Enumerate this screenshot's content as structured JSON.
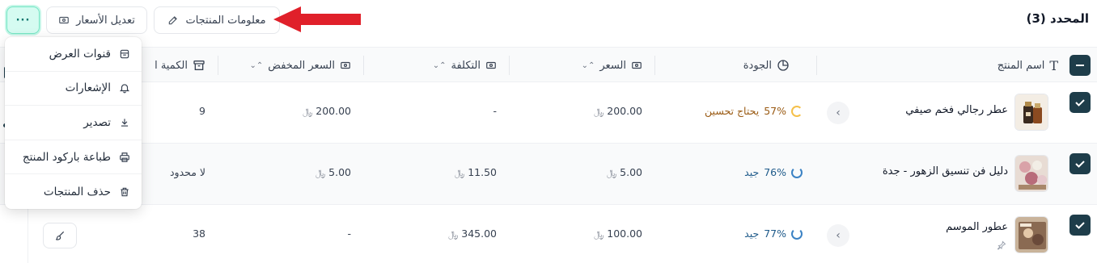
{
  "header": {
    "selected_label": "المحدد (3)",
    "product_info_button": "معلومات المنتجات",
    "edit_prices_button": "تعديل الأسعار",
    "more_button": "···"
  },
  "table": {
    "columns": {
      "name": "اسم المنتج",
      "quality": "الجودة",
      "price": "السعر",
      "cost": "التكلفة",
      "discount_price": "السعر المخفض",
      "quantity": "الكمية ا"
    },
    "rows": [
      {
        "name": "عطر رجالي فخم صيفي",
        "quality_pct": "57%",
        "quality_label": "يحتاج تحسين",
        "price": "200.00",
        "cost": "-",
        "discount_price": "200.00",
        "quantity": "9"
      },
      {
        "name": "دليل فن تنسيق الزهور - جدة",
        "quality_pct": "76%",
        "quality_label": "جيد",
        "price": "5.00",
        "cost": "11.50",
        "discount_price": "5.00",
        "quantity": "لا محدود"
      },
      {
        "name": "عطور الموسم",
        "quality_pct": "77%",
        "quality_label": "جيد",
        "price": "100.00",
        "cost": "345.00",
        "discount_price": "-",
        "quantity": "38"
      }
    ],
    "currency_symbol": "﷼"
  },
  "menu": {
    "items": [
      {
        "label": "قنوات العرض",
        "icon": "store-icon"
      },
      {
        "label": "الإشعارات",
        "icon": "bell-icon"
      },
      {
        "label": "تصدير",
        "icon": "download-icon"
      },
      {
        "label": "طباعة باركود المنتج",
        "icon": "printer-icon"
      },
      {
        "label": "حذف المنتجات",
        "icon": "trash-icon"
      }
    ]
  },
  "colors": {
    "accent_dark": "#1e3d4a",
    "more_button_bg": "#d5fbf1",
    "quality_warn": "#9a5b14",
    "quality_good": "#1e5a8a",
    "annotation_arrow": "#e0202a"
  }
}
